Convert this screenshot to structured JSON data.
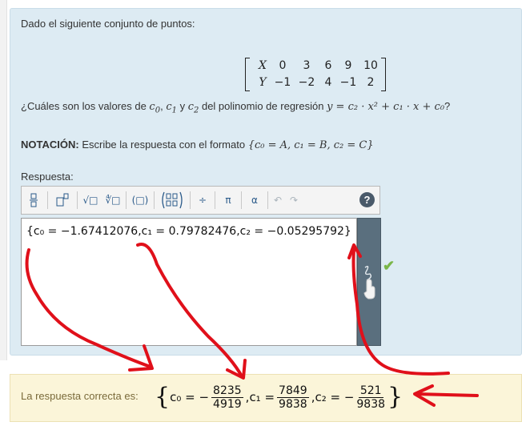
{
  "question": {
    "intro": "Dado el siguiente conjunto de puntos:",
    "matrix": {
      "row_x": [
        "X",
        "0",
        "3",
        "6",
        "9",
        "10"
      ],
      "row_y": [
        "Y",
        "−1",
        "−2",
        "4",
        "−1",
        "2"
      ]
    },
    "text_before": "¿Cuáles son los valores de ",
    "c0": "c",
    "c0_sub": "0",
    "comma": ", ",
    "c1": "c",
    "c1_sub": "1",
    "and_text": " y ",
    "c2": "c",
    "c2_sub": "2",
    "text_middle": " del polinomio de regresión ",
    "polynomial": "y = c₂ · x² + c₁ · x + c₀",
    "question_mark": "?"
  },
  "notation": {
    "bold": "NOTACIÓN:",
    "text": " Escribe la respuesta con el formato ",
    "format": "{c₀ = A, c₁ = B, c₂ = C}"
  },
  "answer": {
    "label": "Respuesta:",
    "toolbar": {
      "fraction": "⁄",
      "superscript": "□▫",
      "sqrt": "√□",
      "nroot": "∜□",
      "paren": "(□)",
      "matrix": "(▫▫)",
      "divide": "÷",
      "pi": "π",
      "alpha": "α",
      "undo": "↶",
      "redo": "↷",
      "help": "?"
    },
    "value": "{c₀ = −1.67412076,c₁ = 0.79782476,c₂ = −0.05295792}"
  },
  "status": {
    "check": "✔"
  },
  "correct": {
    "label": "La respuesta correcta es:",
    "c0_prefix": "c₀ = −",
    "c0_num": "8235",
    "c0_den": "4919",
    "c1_prefix": ",c₁ =",
    "c1_num": "7849",
    "c1_den": "9838",
    "c2_prefix": ",c₂ = −",
    "c2_num": "521",
    "c2_den": "9838",
    "open_brace": "{",
    "close_brace": "}"
  },
  "colors": {
    "panel_bg": "#ddebf3",
    "correct_bg": "#fbf5d9",
    "annotation_red": "#e0101a",
    "check_green": "#7ab648"
  }
}
